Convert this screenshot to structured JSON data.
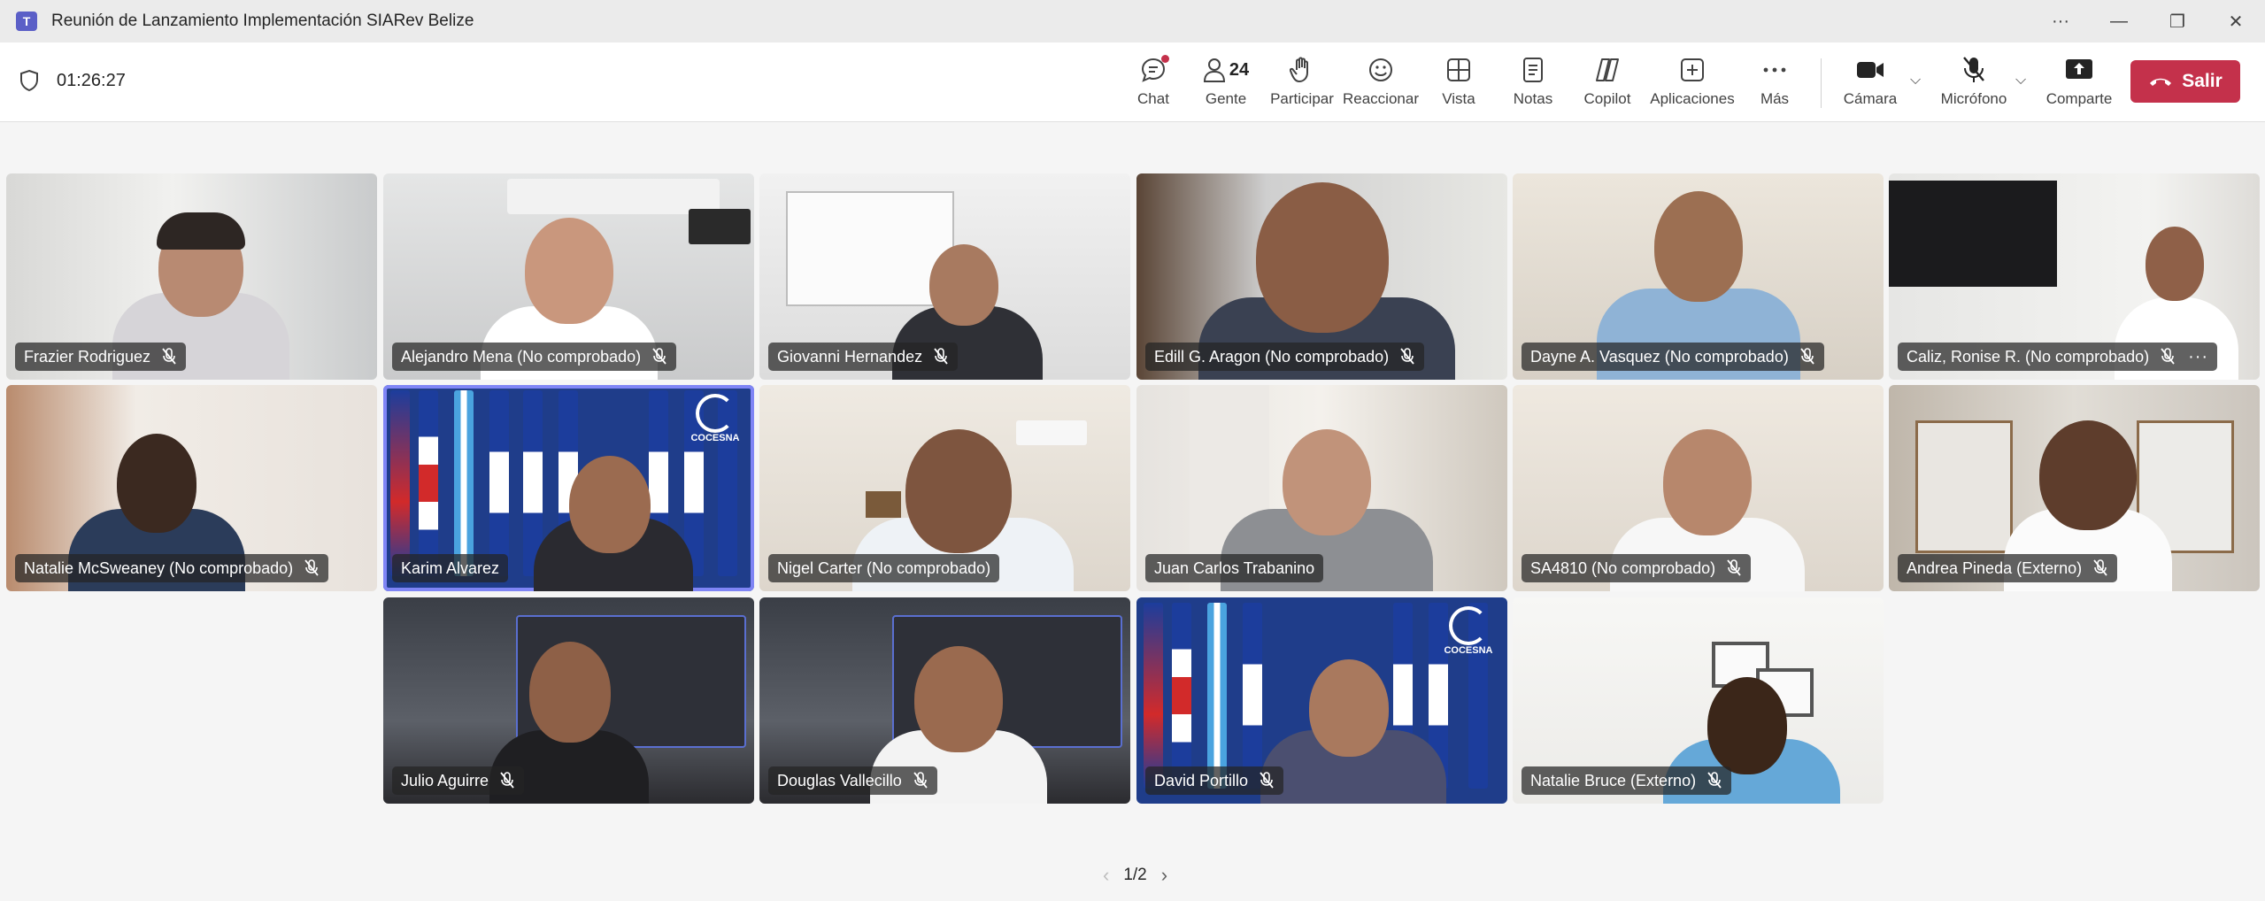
{
  "window": {
    "title": "Reunión de Lanzamiento Implementación SIARev Belize",
    "more_label": "···",
    "minimize_label": "—",
    "restore_label": "❐",
    "close_label": "✕"
  },
  "meeting": {
    "elapsed": "01:26:27",
    "people_count": "24"
  },
  "toolbar": {
    "chat": "Chat",
    "people": "Gente",
    "raise": "Participar",
    "react": "Reaccionar",
    "view": "Vista",
    "notes": "Notas",
    "copilot": "Copilot",
    "apps": "Aplicaciones",
    "more": "Más",
    "camera": "Cámara",
    "mic": "Micrófono",
    "share": "Comparte",
    "leave": "Salir"
  },
  "participants": [
    {
      "name": "Frazier Rodriguez"
    },
    {
      "name": "Alejandro Mena (No comprobado)"
    },
    {
      "name": "Giovanni Hernandez"
    },
    {
      "name": "Edill G. Aragon (No comprobado)"
    },
    {
      "name": "Dayne A. Vasquez (No comprobado)"
    },
    {
      "name": "Caliz, Ronise R. (No comprobado)"
    },
    {
      "name": "Natalie McSweaney (No comprobado)"
    },
    {
      "name": "Karim Alvarez",
      "logo_text": "COCESNA"
    },
    {
      "name": "Nigel Carter (No comprobado)"
    },
    {
      "name": "Juan Carlos Trabanino"
    },
    {
      "name": "SA4810 (No comprobado)"
    },
    {
      "name": "Andrea Pineda (Externo)"
    },
    {
      "name": "Julio Aguirre"
    },
    {
      "name": "Douglas Vallecillo"
    },
    {
      "name": "David Portillo",
      "logo_text": "COCESNA"
    },
    {
      "name": "Natalie Bruce (Externo)"
    }
  ],
  "pager": {
    "label": "1/2",
    "prev": "‹",
    "next": "›"
  },
  "colors": {
    "accent": "#5b5fc7",
    "leave": "#c4314b",
    "active_border": "#7f85f5"
  }
}
